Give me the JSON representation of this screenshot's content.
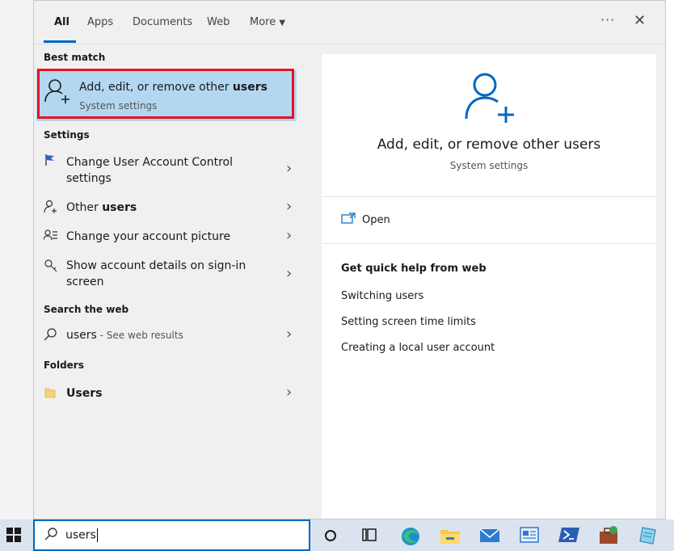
{
  "tabs": {
    "all": "All",
    "apps": "Apps",
    "documents": "Documents",
    "web": "Web",
    "more": "More"
  },
  "header": {
    "ellipsis": "···",
    "close": "✕"
  },
  "best_match": {
    "heading": "Best match",
    "title_prefix": "Add, edit, or remove other ",
    "title_bold": "users",
    "subtitle": "System settings"
  },
  "settings": {
    "heading": "Settings",
    "items": [
      {
        "label": "Change User Account Control settings",
        "icon": "flag-shield-icon"
      },
      {
        "label_prefix": "Other ",
        "label_bold": "users",
        "icon": "person-add-icon"
      },
      {
        "label": "Change your account picture",
        "icon": "account-list-icon"
      },
      {
        "label": "Show account details on sign-in screen",
        "icon": "key-icon"
      }
    ]
  },
  "web_search": {
    "heading": "Search the web",
    "query": "users",
    "suffix": " - See web results"
  },
  "folders": {
    "heading": "Folders",
    "item": "Users"
  },
  "detail": {
    "title": "Add, edit, or remove other users",
    "subtitle": "System settings",
    "open_label": "Open",
    "help_heading": "Get quick help from web",
    "help_links": [
      "Switching users",
      "Setting screen time limits",
      "Creating a local user account"
    ]
  },
  "search": {
    "value": "users"
  },
  "colors": {
    "accent": "#0067c0",
    "highlight": "#b3d7f0",
    "outline": "#e81123"
  },
  "taskbar": {
    "icons": [
      "windows-start-icon",
      "cortana-icon",
      "task-view-icon",
      "edge-icon",
      "file-explorer-icon",
      "mail-icon",
      "control-panel-icon",
      "powershell-icon",
      "toolbox-icon",
      "app-icon"
    ]
  }
}
